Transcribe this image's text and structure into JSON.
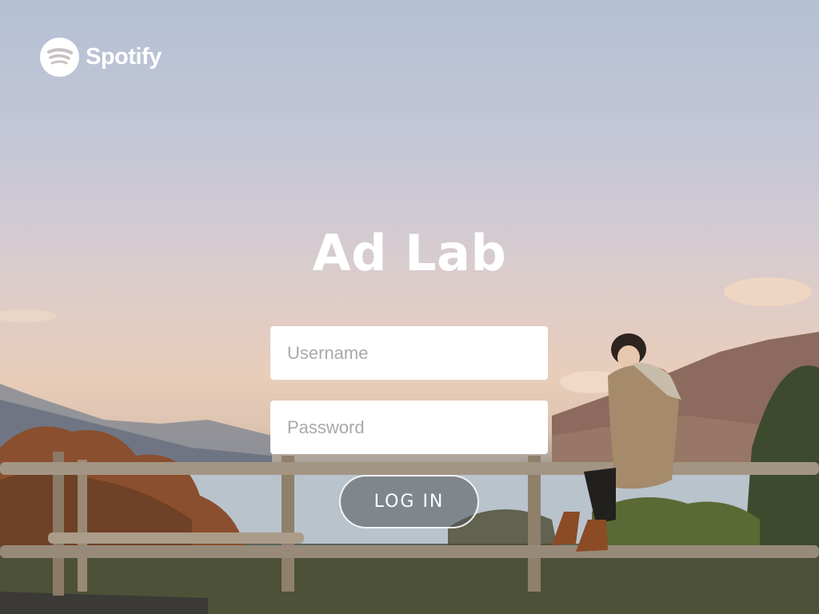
{
  "brand": {
    "name": "Spotify",
    "icon": "spotify-logo-icon",
    "color": "#ffffff"
  },
  "page": {
    "title": "Ad Lab"
  },
  "login_form": {
    "username_placeholder": "Username",
    "username_value": "",
    "password_placeholder": "Password",
    "password_value": "",
    "submit_label": "LOG IN"
  },
  "colors": {
    "sky_top": "#b4c0d4",
    "horizon": "#e8cdb9",
    "button_fill": "#50555a"
  }
}
